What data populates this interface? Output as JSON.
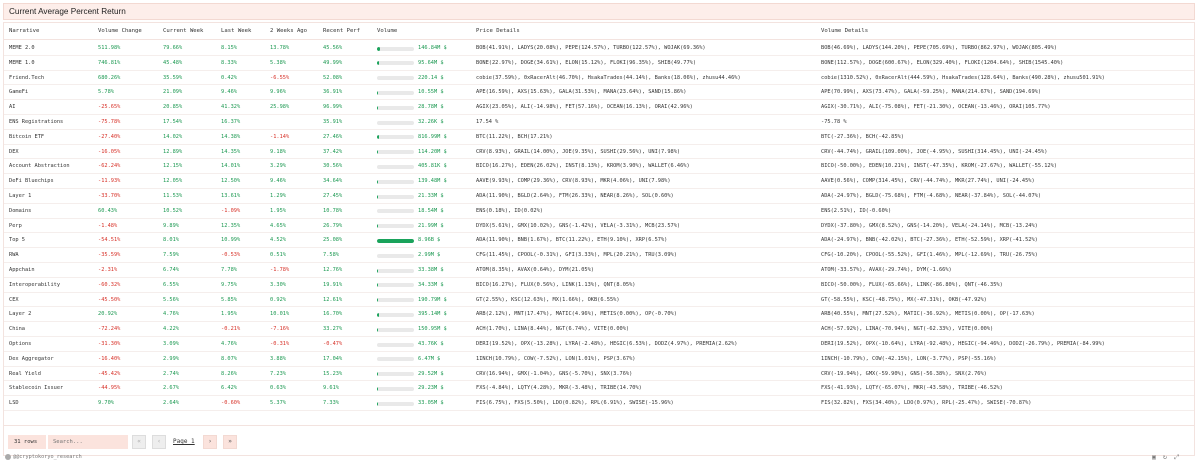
{
  "title": "Current Average Percent Return",
  "headers": [
    "Narrative",
    "Volume Change",
    "Current Week",
    "Last Week",
    "2 Weeks Ago",
    "Recent Perf",
    "Volume",
    "Price Details",
    "Volume Details"
  ],
  "rows": [
    {
      "n": "MEME 2.0",
      "vc": "511.98%",
      "cw": "79.66%",
      "lw": "8.15%",
      "w2": "13.78%",
      "rp": "45.56%",
      "vol": "146.84M $",
      "vf": 0.08,
      "pd": "BOB(41.91%), LADYS(20.08%), PEPE(124.57%), TURBO(122.57%), WOJAK(69.36%)",
      "vd": "BOB(46.69%), LADYS(144.20%), PEPE(705.69%), TURBO(862.97%), WOJAK(805.49%)"
    },
    {
      "n": "MEME 1.0",
      "vc": "746.81%",
      "cw": "45.48%",
      "lw": "8.33%",
      "w2": "5.38%",
      "rp": "49.99%",
      "vol": "95.64M $",
      "vf": 0.06,
      "pd": "BONE(22.97%), DOGE(34.61%), ELON(15.12%), FLOKI(96.35%), SHIB(49.77%)",
      "vd": "BONE(112.57%), DOGE(600.67%), ELON(329.40%), FLOKI(1204.64%), SHIB(1545.40%)"
    },
    {
      "n": "Friend.Tech",
      "vc": "680.26%",
      "cw": "35.59%",
      "lw": "0.42%",
      "w2": "-6.55%",
      "rp": "52.08%",
      "vol": "220.14 $",
      "vf": 0.0,
      "pd": "cobie(37.59%), 0xRacerAlt(46.70%), HsakaTrades(44.14%), Banks(18.06%), zhusu44.46%)",
      "vd": "cobie(1310.52%), 0xRacerAlt(444.59%), HsakaTrades(128.64%), Banks(490.28%), zhusu501.91%)"
    },
    {
      "n": "GameFi",
      "vc": "5.78%",
      "cw": "21.09%",
      "lw": "9.46%",
      "w2": "9.96%",
      "rp": "36.91%",
      "vol": "10.55M $",
      "vf": 0.02,
      "pd": "APE(16.59%), AXS(15.63%), GALA(31.53%), MANA(23.64%), SAND(15.86%)",
      "vd": "APE(70.99%), AXS(73.47%), GALA(-59.25%), MANA(214.67%), SAND(194.69%)"
    },
    {
      "n": "AI",
      "vc": "-25.65%",
      "cw": "20.85%",
      "lw": "41.32%",
      "w2": "25.98%",
      "rp": "96.99%",
      "vol": "28.78M $",
      "vf": 0.03,
      "pd": "AGIX(23.05%), ALI(-14.98%), FET(57.16%), OCEAN(16.13%), ORAI(42.96%)",
      "vd": "AGIX(-30.71%), ALI(-75.08%), FET(-21.30%), OCEAN(-13.46%), ORAI(105.77%)"
    },
    {
      "n": "ENS Registrations",
      "vc": "-75.78%",
      "cw": "17.54%",
      "lw": "16.37%",
      "w2": "",
      "rp": "35.91%",
      "vol": "32.26K $",
      "vf": 0.0,
      "pd": "17.54 %",
      "vd": "-75.78 %"
    },
    {
      "n": "Bitcoin ETF",
      "vc": "-27.40%",
      "cw": "14.02%",
      "lw": "14.38%",
      "w2": "-1.14%",
      "rp": "27.46%",
      "vol": "816.99M $",
      "vf": 0.06,
      "pd": "BTC(11.22%), BCH(17.21%)",
      "vd": "BTC(-27.36%), BCH(-42.85%)"
    },
    {
      "n": "DEX",
      "vc": "-16.05%",
      "cw": "12.89%",
      "lw": "14.35%",
      "w2": "9.18%",
      "rp": "37.42%",
      "vol": "114.20M $",
      "vf": 0.02,
      "pd": "CRV(8.93%), GRAIL(14.00%), JOE(9.35%), SUSHI(29.56%), UNI(7.98%)",
      "vd": "CRV(-44.74%), GRAIL(109.00%), JOE(-4.95%), SUSHI(314.45%), UNI(-24.45%)"
    },
    {
      "n": "Account Abstraction",
      "vc": "-62.24%",
      "cw": "12.15%",
      "lw": "14.01%",
      "w2": "3.29%",
      "rp": "30.56%",
      "vol": "405.81K $",
      "vf": 0.0,
      "pd": "BICO(16.27%), EDEN(26.02%), INST(8.13%), KROM(3.90%), WALLET(6.46%)",
      "vd": "BICO(-50.00%), EDEN(10.21%), INST(-47.35%), KROM(-27.67%), WALLET(-55.12%)"
    },
    {
      "n": "DeFi Bluechips",
      "vc": "-11.93%",
      "cw": "12.05%",
      "lw": "12.50%",
      "w2": "9.46%",
      "rp": "34.64%",
      "vol": "139.48M $",
      "vf": 0.02,
      "pd": "AAVE(9.93%), COMP(29.36%), CRV(8.93%), MKR(4.06%), UNI(7.98%)",
      "vd": "AAVE(0.56%), COMP(314.45%), CRV(-44.74%), MKR(27.74%), UNI(-24.45%)"
    },
    {
      "n": "Layer 1",
      "vc": "-33.70%",
      "cw": "11.53%",
      "lw": "13.61%",
      "w2": "1.29%",
      "rp": "27.45%",
      "vol": "21.33M $",
      "vf": 0.02,
      "pd": "ADA(11.90%), BGLD(2.64%), FTM(26.33%), NEAR(8.26%), SOL(0.60%)",
      "vd": "ADA(-24.97%), BGLD(-75.68%), FTM(-4.68%), NEAR(-37.84%), SOL(-44.07%)"
    },
    {
      "n": "Domains",
      "vc": "60.43%",
      "cw": "10.52%",
      "lw": "-1.09%",
      "w2": "1.95%",
      "rp": "10.78%",
      "vol": "18.54M $",
      "vf": 0.0,
      "pd": "ENS(0.18%), ID(0.02%)",
      "vd": "ENS(2.51%), ID(-0.60%)"
    },
    {
      "n": "Perp",
      "vc": "-1.48%",
      "cw": "9.89%",
      "lw": "12.35%",
      "w2": "4.65%",
      "rp": "26.79%",
      "vol": "21.99M $",
      "vf": 0.02,
      "pd": "DYDX(5.61%), GMX(10.02%), GNS(-1.42%), VELA(-3.31%), MCB(23.57%)",
      "vd": "DYDX(-37.80%), GMX(8.52%), GNS(-14.20%), VELA(-24.14%), MCB(-13.24%)"
    },
    {
      "n": "Top 5",
      "vc": "-54.51%",
      "cw": "8.01%",
      "lw": "10.99%",
      "w2": "4.52%",
      "rp": "25.08%",
      "vol": "8.96B $",
      "vf": 1.0,
      "pd": "ADA(11.90%), BNB(1.67%), BTC(11.22%), ETH(9.10%), XRP(6.57%)",
      "vd": "ADA(-24.97%), BNB(-42.02%), BTC(-27.36%), ETH(-52.59%), XRP(-41.52%)"
    },
    {
      "n": "RWA",
      "vc": "-35.59%",
      "cw": "7.59%",
      "lw": "-0.53%",
      "w2": "0.51%",
      "rp": "7.58%",
      "vol": "2.99M $",
      "vf": 0.0,
      "pd": "CFG(11.45%), CPOOL(-0.31%), GFI(3.33%), MPL(20.21%), TRU(3.09%)",
      "vd": "CFG(-10.20%), CPOOL(-55.52%), GFI(1.46%), MPL(-12.69%), TRU(-26.75%)"
    },
    {
      "n": "Appchain",
      "vc": "-2.31%",
      "cw": "6.74%",
      "lw": "7.78%",
      "w2": "-1.78%",
      "rp": "12.76%",
      "vol": "33.38M $",
      "vf": 0.02,
      "pd": "ATOM(8.35%), AVAX(0.64%), DYM(21.05%)",
      "vd": "ATOM(-33.57%), AVAX(-29.74%), DYM(-1.66%)"
    },
    {
      "n": "Interoperability",
      "vc": "-60.32%",
      "cw": "6.55%",
      "lw": "9.75%",
      "w2": "3.30%",
      "rp": "19.91%",
      "vol": "34.33M $",
      "vf": 0.02,
      "pd": "BICO(16.27%), FLUX(0.56%), LINK(1.13%), QNT(8.05%)",
      "vd": "BICO(-50.00%), FLUX(-65.66%), LINK(-86.80%), QNT(-46.35%)"
    },
    {
      "n": "CEX",
      "vc": "-45.50%",
      "cw": "5.56%",
      "lw": "5.85%",
      "w2": "0.92%",
      "rp": "12.61%",
      "vol": "190.79M $",
      "vf": 0.02,
      "pd": "GT(2.55%), KSC(12.63%), MX(1.66%), OKB(6.55%)",
      "vd": "GT(-58.55%), KSC(-48.75%), MX(-47.31%), OKB(-47.92%)"
    },
    {
      "n": "Layer 2",
      "vc": "20.92%",
      "cw": "4.76%",
      "lw": "1.95%",
      "w2": "10.01%",
      "rp": "16.70%",
      "vol": "395.14M $",
      "vf": 0.05,
      "pd": "ARB(2.12%), MNT(17.47%), MATIC(4.96%), METIS(0.00%), OP(-0.70%)",
      "vd": "ARB(40.55%), MNT(27.52%), MATIC(-36.92%), METIS(0.00%), OP(-17.63%)"
    },
    {
      "n": "China",
      "vc": "-72.24%",
      "cw": "4.22%",
      "lw": "-0.21%",
      "w2": "-7.16%",
      "rp": "33.27%",
      "vol": "150.95M $",
      "vf": 0.02,
      "pd": "ACH(1.70%), LINA(8.44%), NGT(6.74%), VITE(0.00%)",
      "vd": "ACH(-57.92%), LINA(-70.94%), NGT(-62.33%), VITE(0.00%)"
    },
    {
      "n": "Options",
      "vc": "-31.30%",
      "cw": "3.09%",
      "lw": "4.76%",
      "w2": "-0.31%",
      "rp": "-0.47%",
      "vol": "43.76K $",
      "vf": 0.0,
      "pd": "DERI(19.52%), OPX(-13.28%), LYRA(-2.48%), HEGIC(6.53%), DODZ(4.97%), PREMIA(2.62%)",
      "vd": "DERI(19.52%), OPX(-10.64%), LYRA(-92.48%), HEGIC(-94.46%), DODZ(-26.79%), PREMIA(-84.99%)"
    },
    {
      "n": "Dex Aggregator",
      "vc": "-16.40%",
      "cw": "2.99%",
      "lw": "8.07%",
      "w2": "3.88%",
      "rp": "17.04%",
      "vol": "6.47M $",
      "vf": 0.0,
      "pd": "1INCH(10.79%), COW(-7.52%), LON(1.01%), PSP(3.67%)",
      "vd": "1INCH(-10.79%), COW(-42.15%), LON(-3.77%), PSP(-55.16%)"
    },
    {
      "n": "Real Yield",
      "vc": "-45.42%",
      "cw": "2.74%",
      "lw": "8.26%",
      "w2": "7.23%",
      "rp": "15.23%",
      "vol": "29.52M $",
      "vf": 0.02,
      "pd": "CRV(16.94%), GMX(-1.04%), GNS(-5.70%), SNX(3.76%)",
      "vd": "CRV(-19.94%), GMX(-59.90%), GNS(-56.38%), SNX(2.76%)"
    },
    {
      "n": "Stablecoin Issuer",
      "vc": "-44.95%",
      "cw": "2.67%",
      "lw": "6.42%",
      "w2": "0.63%",
      "rp": "9.61%",
      "vol": "29.23M $",
      "vf": 0.02,
      "pd": "FXS(-4.84%), LQTY(4.28%), MKR(-3.48%), TRIBE(14.70%)",
      "vd": "FXS(-41.93%), LQTY(-65.07%), MKR(-43.58%), TRIBE(-46.52%)"
    },
    {
      "n": "LSD",
      "vc": "9.70%",
      "cw": "2.64%",
      "lw": "-0.60%",
      "w2": "5.37%",
      "rp": "7.33%",
      "vol": "33.05M $",
      "vf": 0.02,
      "pd": "FIS(6.75%), FXS(5.50%), LDO(0.82%), RPL(6.91%), SWISE(-15.96%)",
      "vd": "FIS(32.82%), FXS(34.40%), LDO(0.97%), RPL(-25.47%), SWISE(-70.87%)"
    }
  ],
  "footer": {
    "rows_count": "31 rows",
    "search_placeholder": "Search...",
    "page_label": "Page 1",
    "prev_icons": [
      "first-page-icon",
      "prev-page-icon"
    ],
    "next_icons": [
      "next-page-icon",
      "last-page-icon"
    ]
  },
  "credit": "@@cryptokoryo_research",
  "bottom_icons": [
    "camera-icon",
    "refresh-icon",
    "fullscreen-icon"
  ],
  "colors": {
    "positive": "#1a9850",
    "negative": "#d73027",
    "accent": "#fbe3dd",
    "bar": "#1aa35b"
  }
}
